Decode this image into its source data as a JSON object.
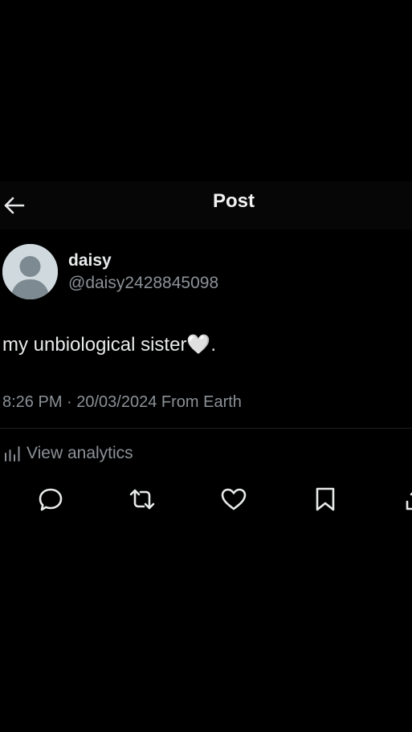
{
  "header": {
    "title": "Post",
    "back_icon": "arrow-left-icon"
  },
  "author": {
    "display_name": "daisy",
    "handle": "@daisy2428845098",
    "avatar_icon": "default-avatar-icon"
  },
  "post": {
    "text": "my unbiological sister🤍.",
    "meta": "8:26 PM · 20/03/2024 From Earth"
  },
  "analytics": {
    "label": "View analytics",
    "icon": "bar-chart-icon"
  },
  "actions": [
    {
      "name": "reply",
      "icon": "reply-icon"
    },
    {
      "name": "repost",
      "icon": "repost-icon"
    },
    {
      "name": "like",
      "icon": "heart-icon"
    },
    {
      "name": "bookmark",
      "icon": "bookmark-icon"
    },
    {
      "name": "share",
      "icon": "share-icon"
    }
  ],
  "colors": {
    "background": "#000000",
    "header_background": "#060606",
    "primary_text": "#e7e9ea",
    "secondary_text": "#8b9196",
    "icon": "#e7e9ea",
    "avatar_bg": "#cfd9de",
    "avatar_fg": "#7e8a92"
  }
}
